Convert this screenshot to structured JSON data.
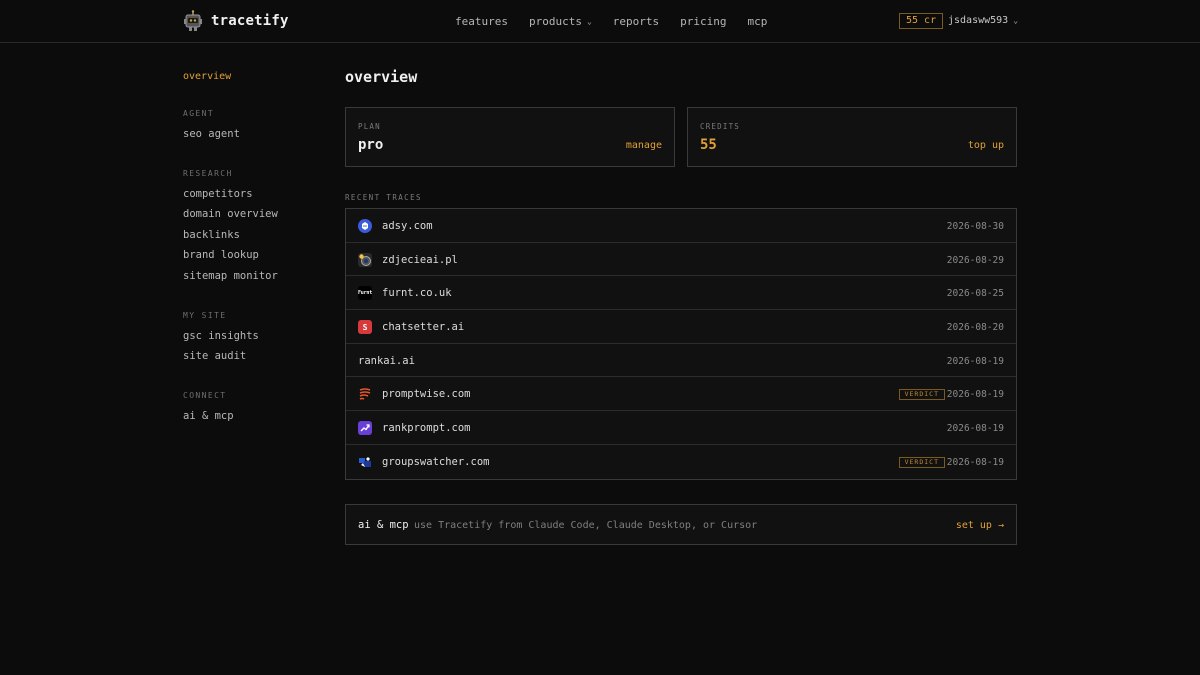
{
  "header": {
    "brand": "tracetify",
    "nav": [
      {
        "label": "features",
        "has_dropdown": false
      },
      {
        "label": "products",
        "has_dropdown": true
      },
      {
        "label": "reports",
        "has_dropdown": false
      },
      {
        "label": "pricing",
        "has_dropdown": false
      },
      {
        "label": "mcp",
        "has_dropdown": false
      }
    ],
    "credits_badge": "55 cr",
    "username": "jsdasww593"
  },
  "sidebar": {
    "active": "overview",
    "groups": [
      {
        "heading": "AGENT",
        "items": [
          "seo agent"
        ]
      },
      {
        "heading": "RESEARCH",
        "items": [
          "competitors",
          "domain overview",
          "backlinks",
          "brand lookup",
          "sitemap monitor"
        ]
      },
      {
        "heading": "MY SITE",
        "items": [
          "gsc insights",
          "site audit"
        ]
      },
      {
        "heading": "CONNECT",
        "items": [
          "ai & mcp"
        ]
      }
    ]
  },
  "main": {
    "title": "overview",
    "plan_card": {
      "label": "PLAN",
      "value": "pro",
      "action": "manage"
    },
    "credits_card": {
      "label": "CREDITS",
      "value": "55",
      "action": "top up"
    },
    "recent_label": "RECENT TRACES",
    "traces": [
      {
        "domain": "adsy.com",
        "date": "2026-08-30",
        "verdict": null,
        "icon": "adsy-logo-icon"
      },
      {
        "domain": "zdjecieai.pl",
        "date": "2026-08-29",
        "verdict": null,
        "icon": "camera-logo-icon"
      },
      {
        "domain": "furnt.co.uk",
        "date": "2026-08-25",
        "verdict": null,
        "icon": "furnt-logo-icon",
        "icon_text": "Furnt"
      },
      {
        "domain": "chatsetter.ai",
        "date": "2026-08-20",
        "verdict": null,
        "icon": "chatsetter-logo-icon",
        "icon_text": "S"
      },
      {
        "domain": "rankai.ai",
        "date": "2026-08-19",
        "verdict": null,
        "icon": null
      },
      {
        "domain": "promptwise.com",
        "date": "2026-08-19",
        "verdict": "VERDICT",
        "icon": "promptwise-logo-icon"
      },
      {
        "domain": "rankprompt.com",
        "date": "2026-08-19",
        "verdict": null,
        "icon": "trend-up-logo-icon"
      },
      {
        "domain": "groupswatcher.com",
        "date": "2026-08-19",
        "verdict": "VERDICT",
        "icon": "groupswatcher-logo-icon"
      }
    ],
    "mcp": {
      "title": "ai & mcp",
      "description": "use Tracetify from Claude Code, Claude Desktop, or Cursor",
      "action": "set up →"
    }
  },
  "colors": {
    "accent": "#e0a038",
    "background": "#0c0c0c",
    "border": "#3a3a3a"
  }
}
